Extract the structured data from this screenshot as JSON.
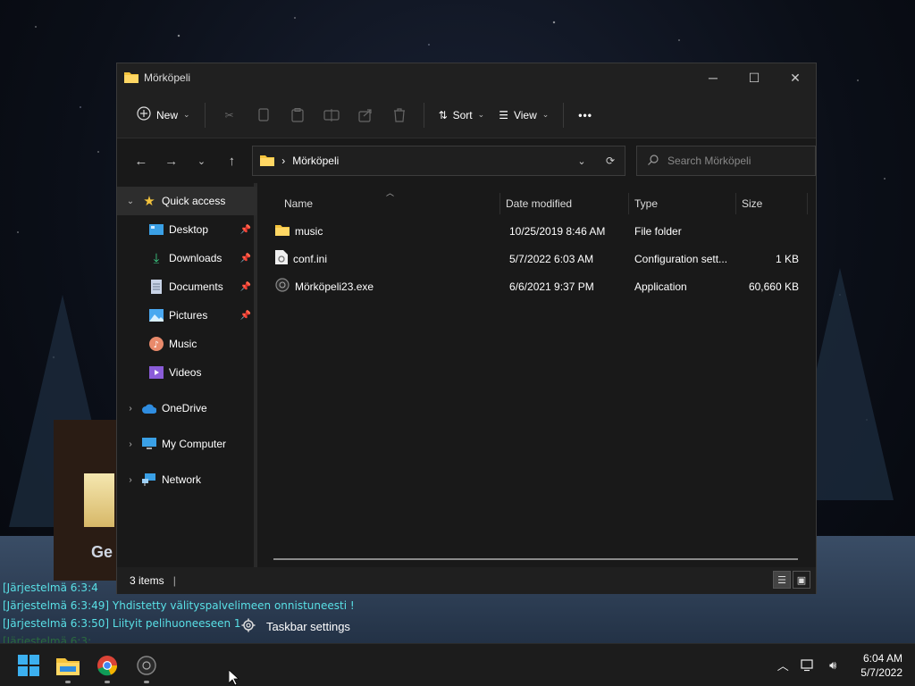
{
  "window": {
    "title": "Mörköpeli",
    "minimize": "─",
    "maximize": "☐",
    "close": "✕"
  },
  "toolbar": {
    "new_label": "New",
    "sort_label": "Sort",
    "view_label": "View",
    "more_label": "•••"
  },
  "address": {
    "path": "Mörköpeli",
    "separator": "›"
  },
  "search": {
    "placeholder": "Search Mörköpeli"
  },
  "sidebar": {
    "quick_access": "Quick access",
    "items": [
      {
        "label": "Desktop",
        "icon": "desktop-icon",
        "pinned": true
      },
      {
        "label": "Downloads",
        "icon": "downloads-icon",
        "pinned": true
      },
      {
        "label": "Documents",
        "icon": "documents-icon",
        "pinned": true
      },
      {
        "label": "Pictures",
        "icon": "pictures-icon",
        "pinned": true
      },
      {
        "label": "Music",
        "icon": "music-icon",
        "pinned": false
      },
      {
        "label": "Videos",
        "icon": "videos-icon",
        "pinned": false
      }
    ],
    "onedrive": "OneDrive",
    "my_computer": "My Computer",
    "network": "Network"
  },
  "columns": {
    "name": "Name",
    "date": "Date modified",
    "type": "Type",
    "size": "Size"
  },
  "files": [
    {
      "name": "music",
      "date": "10/25/2019 8:46 AM",
      "type": "File folder",
      "size": "",
      "icon": "folder-icon"
    },
    {
      "name": "conf.ini",
      "date": "5/7/2022 6:03 AM",
      "type": "Configuration sett...",
      "size": "1 KB",
      "icon": "config-file-icon"
    },
    {
      "name": "Mörköpeli23.exe",
      "date": "6/6/2021 9:37 PM",
      "type": "Application",
      "size": "60,660 KB",
      "icon": "exe-icon"
    }
  ],
  "status": {
    "items_count": "3 items"
  },
  "chat": {
    "line1": "[Järjestelmä 6:3:4",
    "line2": "[Järjestelmä 6:3:49] Yhdistetty välityspalvelimeen onnistuneesti !",
    "line3": "[Järjestelmä 6:3:50] Liityit pelihuoneeseen 1",
    "line4": "[Järjestelmä 6:3:..."
  },
  "desktop": {
    "partial_text": "Ge"
  },
  "tooltip": {
    "label": "Taskbar settings"
  },
  "clock": {
    "time": "6:04 AM",
    "date": "5/7/2022"
  },
  "colors": {
    "accent_folder": "#f3c33d",
    "chat_text": "#59e0e6",
    "window_bg": "#1f1f1f"
  }
}
